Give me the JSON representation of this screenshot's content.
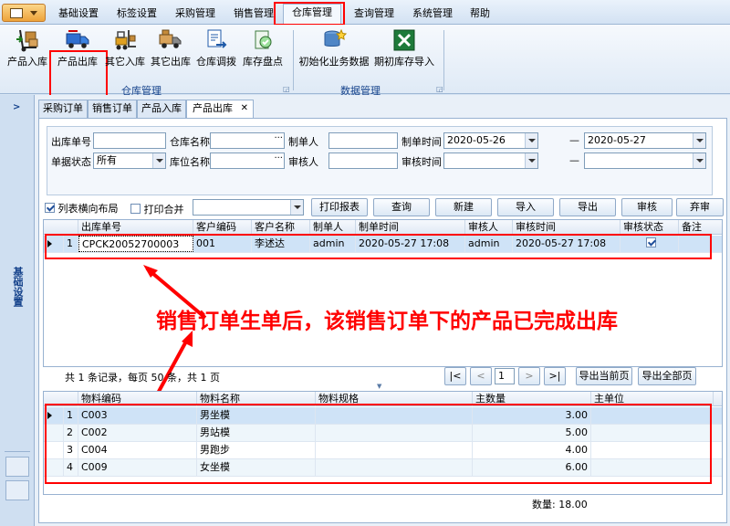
{
  "menubar": {
    "tabs": [
      "基础设置",
      "标签设置",
      "采购管理",
      "销售管理",
      "仓库管理",
      "查询管理",
      "系统管理",
      "帮助"
    ],
    "active_index": 4
  },
  "ribbon": {
    "buttons": [
      "产品入库",
      "产品出库",
      "其它入库",
      "其它出库",
      "仓库调拨",
      "库存盘点",
      "初始化业务数据",
      "期初库存导入"
    ],
    "group1_label": "仓库管理",
    "group2_label": "数据管理"
  },
  "sidebar": {
    "label": "基础设置"
  },
  "doc_tabs": [
    "采购订单",
    "销售订单",
    "产品入库",
    "产品出库"
  ],
  "doc_tab_close": "✕",
  "filters": {
    "out_no_label": "出库单号",
    "warehouse_label": "仓库名称",
    "maker_label": "制单人",
    "make_time_label": "制单时间",
    "make_time_from": "2020-05-26",
    "dash": "—",
    "make_time_to": "2020-05-27",
    "status_label": "单据状态",
    "status_value": "所有",
    "location_label": "库位名称",
    "auditor_label": "审核人",
    "audit_time_label": "审核时间"
  },
  "toolbar": {
    "layout_label": "列表横向布局",
    "print_merge_label": "打印合并",
    "buttons": [
      "打印报表",
      "查询",
      "新建",
      "导入",
      "导出",
      "审核",
      "弃审"
    ]
  },
  "top_grid": {
    "headers": [
      "出库单号",
      "客户编码",
      "客户名称",
      "制单人",
      "制单时间",
      "审核人",
      "审核时间",
      "审核状态",
      "备注"
    ],
    "rows": [
      {
        "idx": "1",
        "no": "CPCK20052700003",
        "code": "001",
        "name": "李述达",
        "maker": "admin",
        "make_time": "2020-05-27 17:08",
        "auditor": "admin",
        "audit_time": "2020-05-27 17:08",
        "audited": true,
        "note": ""
      }
    ]
  },
  "annotation": "销售订单生单后，该销售订单下的产品已完成出库",
  "pager": {
    "summary": "共 1 条记录，每页 50 条，共 1 页",
    "first": "|<",
    "prev": "<",
    "page": "1",
    "next": ">",
    "last": ">|",
    "export_current": "导出当前页",
    "export_all": "导出全部页"
  },
  "bottom_grid": {
    "headers": [
      "物料编码",
      "物料名称",
      "物料规格",
      "主数量",
      "主单位"
    ],
    "rows": [
      {
        "idx": "1",
        "code": "C003",
        "name": "男坐模",
        "spec": "",
        "qty": "3.00",
        "unit": ""
      },
      {
        "idx": "2",
        "code": "C002",
        "name": "男站模",
        "spec": "",
        "qty": "5.00",
        "unit": ""
      },
      {
        "idx": "3",
        "code": "C004",
        "name": "男跑步",
        "spec": "",
        "qty": "4.00",
        "unit": ""
      },
      {
        "idx": "4",
        "code": "C009",
        "name": "女坐模",
        "spec": "",
        "qty": "6.00",
        "unit": ""
      }
    ],
    "total_label": "数量: 18.00"
  },
  "colors": {
    "highlight": "#ff0000",
    "selected_row": "#cfe3f7",
    "alt_row": "#eef6fb"
  }
}
